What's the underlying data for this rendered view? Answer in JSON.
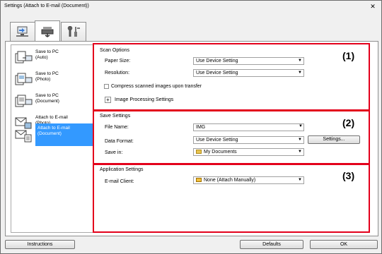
{
  "window": {
    "title": "Settings (Attach to E-mail (Document))",
    "close_label": "✕"
  },
  "tabs": [
    {
      "name": "scan-from-computer",
      "active": false
    },
    {
      "name": "scan-from-operation-panel",
      "active": true
    },
    {
      "name": "general-settings",
      "active": false
    }
  ],
  "sidebar": {
    "items": [
      {
        "line1": "Save to PC",
        "line2": "(Auto)"
      },
      {
        "line1": "Save to PC",
        "line2": "(Photo)"
      },
      {
        "line1": "Save to PC",
        "line2": "(Document)"
      },
      {
        "line1": "Attach to E-mail",
        "line2": "(Photo)"
      },
      {
        "line1": "Attach to E-mail",
        "line2": "(Document)"
      }
    ],
    "selected_index": 4
  },
  "scan_options": {
    "title": "Scan Options",
    "number": "(1)",
    "paper_size_label": "Paper Size:",
    "paper_size_value": "Use Device Setting",
    "resolution_label": "Resolution:",
    "resolution_value": "Use Device Setting",
    "compress_label": "Compress scanned images upon transfer",
    "compress_checked": false,
    "image_processing_label": "Image Processing Settings",
    "expand_symbol": "+"
  },
  "save_settings": {
    "title": "Save Settings",
    "number": "(2)",
    "file_name_label": "File Name:",
    "file_name_value": "IMG",
    "data_format_label": "Data Format:",
    "data_format_value": "Use Device Setting",
    "settings_button": "Settings...",
    "save_in_label": "Save in:",
    "save_in_value": "My Documents"
  },
  "application_settings": {
    "title": "Application Settings",
    "number": "(3)",
    "email_client_label": "E-mail Client:",
    "email_client_value": "None (Attach Manually)"
  },
  "footer": {
    "instructions": "Instructions",
    "defaults": "Defaults",
    "ok": "OK"
  },
  "colors": {
    "highlight": "#e3001b",
    "selection": "#3399ff"
  }
}
